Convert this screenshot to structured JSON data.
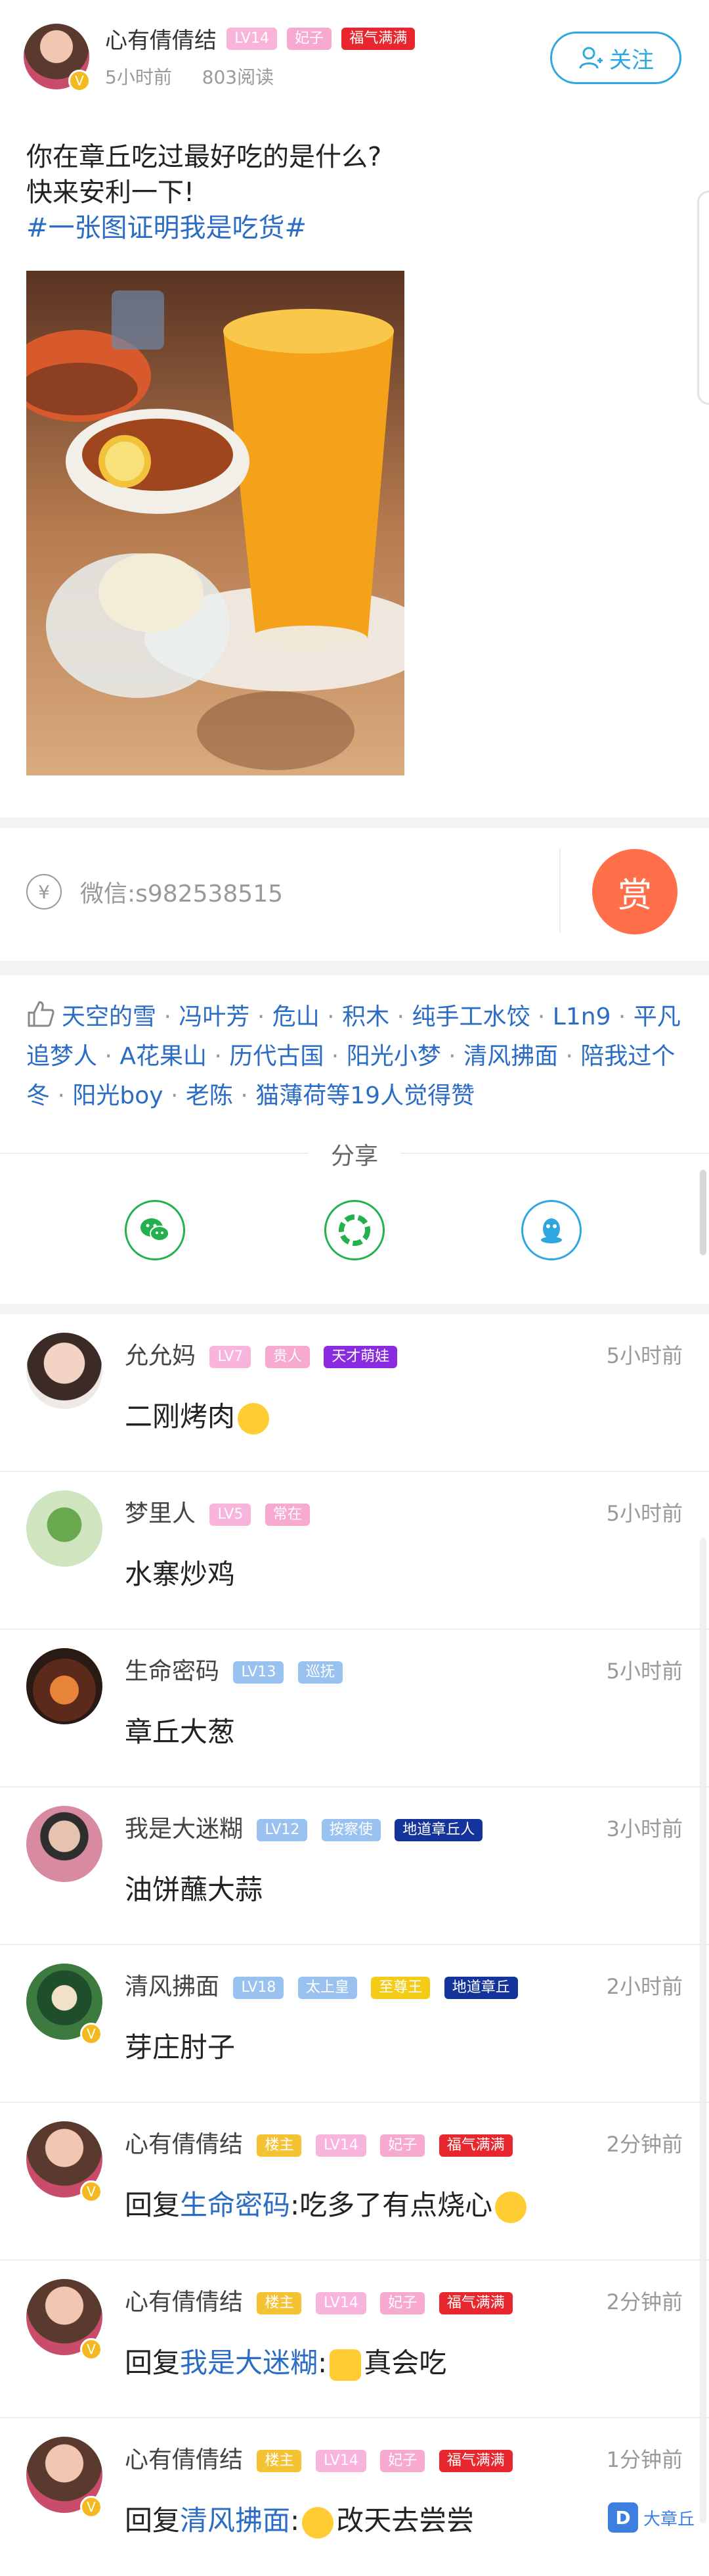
{
  "post": {
    "author": "心有倩倩结",
    "badges": [
      "LV14",
      "妃子",
      "福气满满"
    ],
    "time": "5小时前",
    "reads": "803阅读",
    "follow_label": "关注",
    "text_line1": "你在章丘吃过最好吃的是什么?",
    "text_line2": "快来安利一下!",
    "topic": "#一张图证明我是吃货#"
  },
  "tip": {
    "currency_icon": "¥",
    "wechat": "微信:s982538515",
    "reward_label": "赏"
  },
  "likes": {
    "names": [
      "天空的雪",
      "冯叶芳",
      "危山",
      "积木",
      "纯手工水饺",
      "L1n9",
      "平凡追梦人",
      "A花果山",
      "历代古国",
      "阳光小梦",
      "清风拂面",
      "陪我过个冬",
      "阳光boy",
      "老陈",
      "猫薄荷"
    ],
    "tail": "等19人觉得赞"
  },
  "share": {
    "label": "分享",
    "icons": [
      "wechat-icon",
      "moments-icon",
      "qq-icon"
    ],
    "colors": {
      "wechat": "#22b14c",
      "moments": "#22b14c",
      "qq": "#2ea7e0"
    }
  },
  "comments": [
    {
      "name": "允允妈",
      "badges": [
        "LV7",
        "贵人",
        "天才萌娃"
      ],
      "time": "5小时前",
      "body": "二刚烤肉"
    },
    {
      "name": "梦里人",
      "badges": [
        "LV5",
        "常在"
      ],
      "time": "5小时前",
      "body": "水寨炒鸡"
    },
    {
      "name": "生命密码",
      "badges": [
        "LV13",
        "巡抚"
      ],
      "time": "5小时前",
      "body": "章丘大葱"
    },
    {
      "name": "我是大迷糊",
      "badges": [
        "LV12",
        "按察使",
        "地道章丘人"
      ],
      "time": "3小时前",
      "body": "油饼蘸大蒜"
    },
    {
      "name": "清风拂面",
      "badges": [
        "LV18",
        "太上皇",
        "至尊王",
        "地道章丘"
      ],
      "time": "2小时前",
      "body": "芽庄肘子"
    },
    {
      "name": "心有倩倩结",
      "badges": [
        "楼主",
        "LV14",
        "妃子",
        "福气满满"
      ],
      "time": "2分钟前",
      "reply_prefix": "回复",
      "reply_to": "生命密码",
      "reply_text": ":吃多了有点烧心"
    },
    {
      "name": "心有倩倩结",
      "badges": [
        "楼主",
        "LV14",
        "妃子",
        "福气满满"
      ],
      "time": "2分钟前",
      "reply_prefix": "回复",
      "reply_to": "我是大迷糊",
      "reply_text": ":",
      "reply_text2": "真会吃"
    },
    {
      "name": "心有倩倩结",
      "badges": [
        "楼主",
        "LV14",
        "妃子",
        "福气满满"
      ],
      "time": "1分钟前",
      "reply_prefix": "回复",
      "reply_to": "清风拂面",
      "reply_text": ":",
      "reply_text2": "改天去尝尝"
    }
  ],
  "watermark": "大章丘"
}
